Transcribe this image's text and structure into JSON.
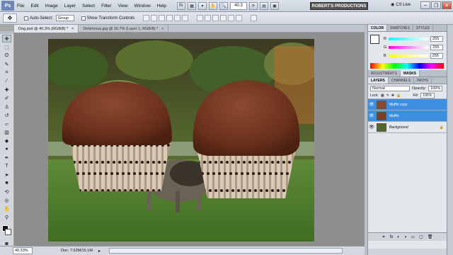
{
  "menu": {
    "logo": "Ps",
    "items": [
      "File",
      "Edit",
      "Image",
      "Layer",
      "Select",
      "Filter",
      "View",
      "Window",
      "Help"
    ],
    "zoom": "40.3",
    "brand": "ROBERT'S PRODUCTIONS",
    "cs_live": "CS Live",
    "icons": [
      "bridge-icon",
      "mini-bridge-icon",
      "extras-icon",
      "hand-icon",
      "zoom-icon",
      "rotate-icon",
      "arrange-icon",
      "screen-mode-icon"
    ]
  },
  "options": {
    "auto_select_label": "Auto-Select:",
    "auto_select_value": "Group",
    "transform_label": "Show Transform Controls"
  },
  "tabs": [
    {
      "label": "Dog.psd @ 40.3% (RGB/8) *",
      "active": true
    },
    {
      "label": "Delishrous.jpg @ 16.7% (Layer 1, RGB/8) *",
      "active": false
    }
  ],
  "tools": [
    "move",
    "marquee",
    "lasso",
    "quick-select",
    "crop",
    "eyedropper",
    "healing",
    "brush",
    "clone",
    "history-brush",
    "eraser",
    "gradient",
    "blur",
    "dodge",
    "pen",
    "type",
    "path-select",
    "shape",
    "3d-rotate",
    "3d-orbit",
    "hand",
    "zoom"
  ],
  "status": {
    "zoom": "40.33%",
    "doc": "Doc: 7.52M/15.1M"
  },
  "color_panel": {
    "tabs": [
      "COLOR",
      "SWATCHES",
      "STYLES"
    ],
    "r_label": "R",
    "g_label": "G",
    "b_label": "B",
    "r": "255",
    "g": "255",
    "b": "255"
  },
  "adjust_tabs": [
    "ADJUSTMENTS",
    "MASKS"
  ],
  "layers_panel": {
    "tabs": [
      "LAYERS",
      "CHANNELS",
      "PATHS"
    ],
    "blend": "Normal",
    "opacity_label": "Opacity:",
    "opacity": "100%",
    "lock_label": "Lock:",
    "fill_label": "Fill:",
    "fill": "100%",
    "layers": [
      {
        "name": "Muffin copy",
        "selected": true
      },
      {
        "name": "Muffin",
        "selected": true
      },
      {
        "name": "Background",
        "selected": false,
        "italic": true
      }
    ]
  },
  "colors": {
    "selection_blue": "#3d8fe0",
    "canvas_gray": "#8e8e8e"
  }
}
